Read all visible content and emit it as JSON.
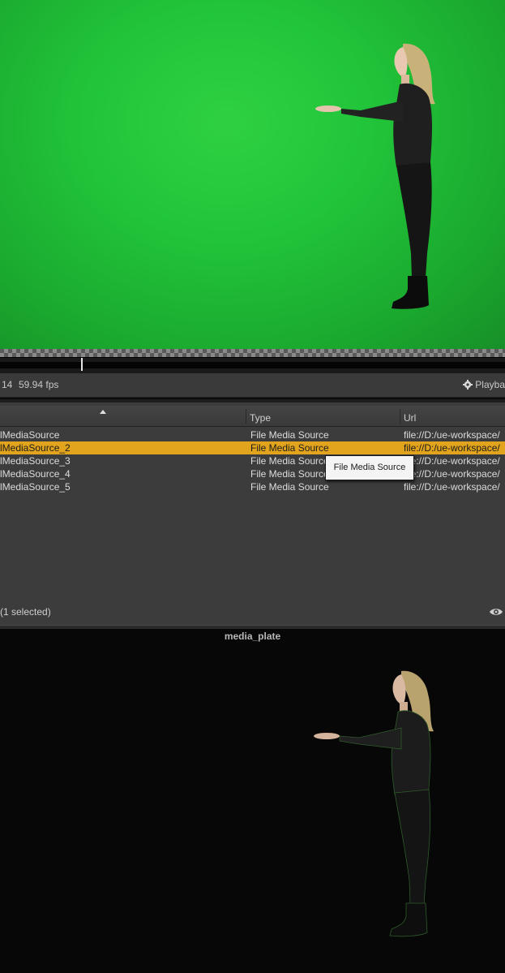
{
  "timeline": {
    "frame": "14",
    "fps": "59.94 fps",
    "playback_label": "Playba"
  },
  "media_list": {
    "columns": {
      "name": "",
      "type": "Type",
      "url": "Url"
    },
    "rows": [
      {
        "name": "lMediaSource",
        "type": "File Media Source",
        "url": "file://D:/ue-workspace/"
      },
      {
        "name": "lMediaSource_2",
        "type": "File Media Source",
        "url": "file://D:/ue-workspace/",
        "selected": true
      },
      {
        "name": "lMediaSource_3",
        "type": "File Media Source",
        "url": "file://D:/ue-workspace/"
      },
      {
        "name": "lMediaSource_4",
        "type": "File Media Source",
        "url": "file://D:/ue-workspace/"
      },
      {
        "name": "lMediaSource_5",
        "type": "File Media Source",
        "url": "file://D:/ue-workspace/"
      }
    ],
    "tooltip": "File Media Source",
    "selection_count": "(1 selected)"
  },
  "plate": {
    "title": "media_plate"
  },
  "colors": {
    "green_screen": "#22c53a",
    "selected_row": "#e2a41c",
    "panel_bg": "#3c3c3c",
    "plate_bg": "#070707"
  },
  "icons": {
    "playback_settings": "gear-icon",
    "view_options": "eye-icon",
    "sort": "sort-ascending-icon"
  }
}
